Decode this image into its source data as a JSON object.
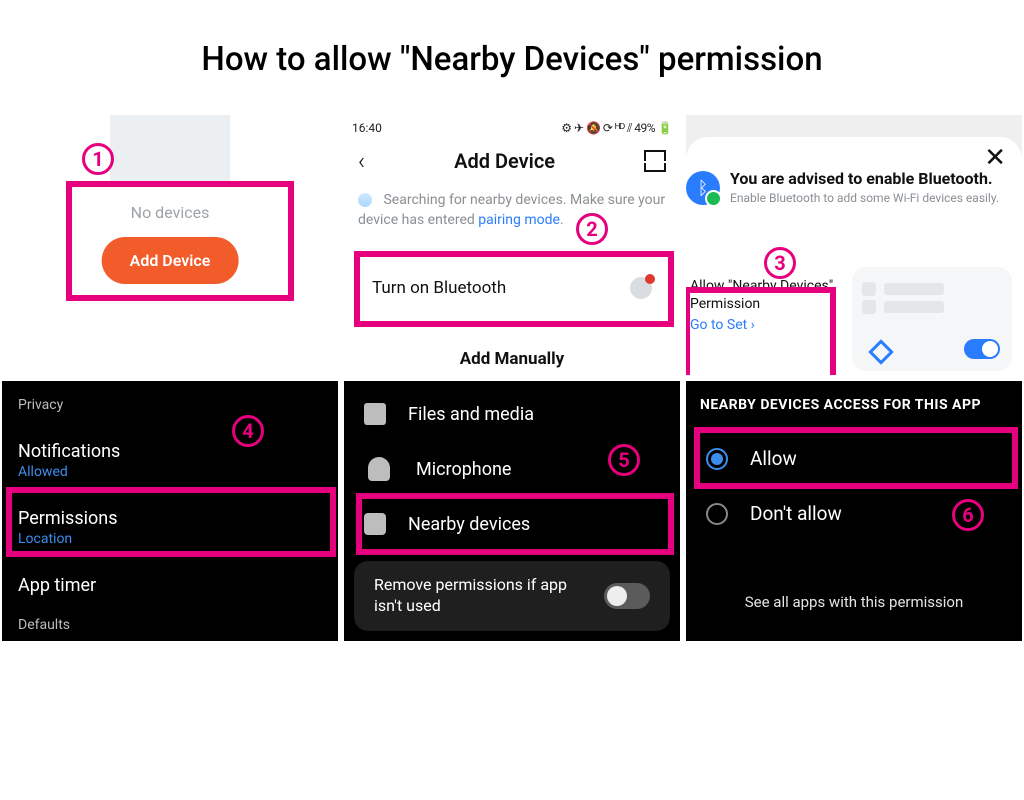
{
  "title": "How to allow \"Nearby Devices\" permission",
  "steps": {
    "s1": "1",
    "s2": "2",
    "s3": "3",
    "s4": "4",
    "s5": "5",
    "s6": "6"
  },
  "p1": {
    "no_devices": "No devices",
    "add_device": "Add Device"
  },
  "p2": {
    "time": "16:40",
    "status_right": "⚙ ✈ 🔕 ⟳ ᴴᴰ ⫽ 49% 🔋",
    "back": "‹",
    "title": "Add Device",
    "info_a": "Searching for nearby devices. Make sure your device has entered ",
    "info_link": "pairing mode",
    "info_dot": ".",
    "bt_label": "Turn on Bluetooth",
    "add_manually": "Add Manually"
  },
  "p3": {
    "close": "✕",
    "bt_glyph": "ᛒ",
    "heading": "You are advised to enable Bluetooth.",
    "sub": "Enable Bluetooth to add some Wi-Fi devices easily.",
    "allow": "Allow \"Nearby Devices\" Permission",
    "go": "Go to Set  ›"
  },
  "p4": {
    "privacy": "Privacy",
    "notifications": "Notifications",
    "notifications_sub": "Allowed",
    "permissions": "Permissions",
    "permissions_sub": "Location",
    "app_timer": "App timer",
    "defaults": "Defaults"
  },
  "p5": {
    "files": "Files and media",
    "mic": "Microphone",
    "nearby": "Nearby devices",
    "remove": "Remove permissions if app isn't used"
  },
  "p6": {
    "header": "NEARBY DEVICES ACCESS FOR THIS APP",
    "allow": "Allow",
    "dont": "Don't allow",
    "see": "See all apps with this permission"
  }
}
